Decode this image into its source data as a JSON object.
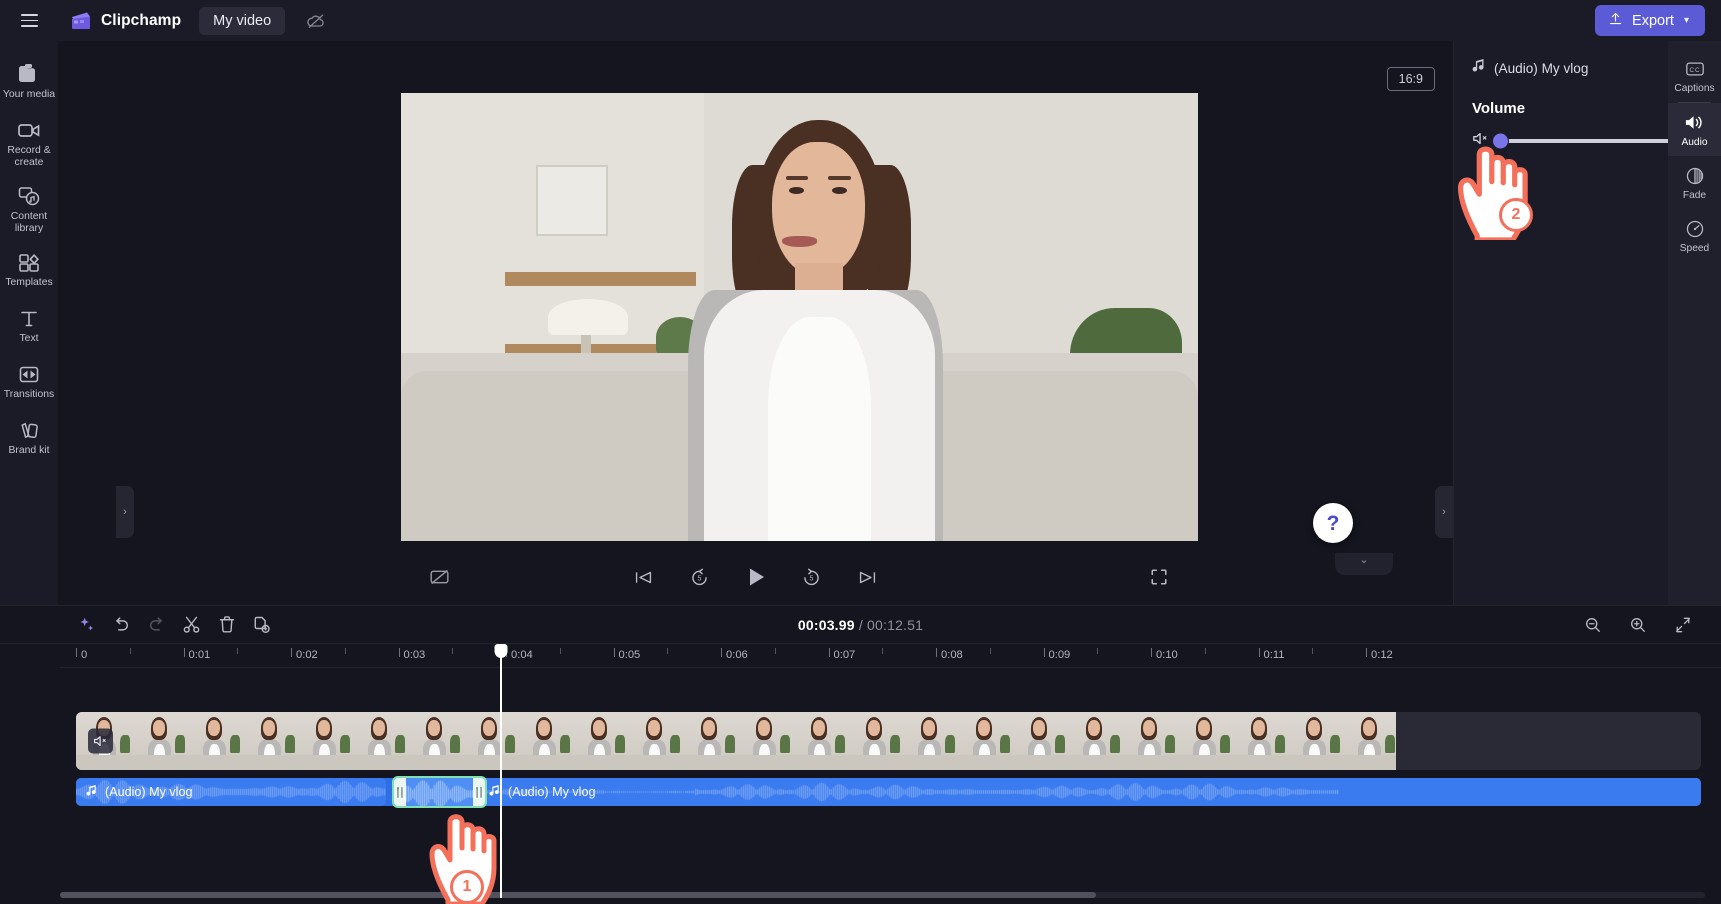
{
  "topbar": {
    "menu_icon": "hamburger-icon",
    "brand": "Clipchamp",
    "project_name": "My video",
    "cloud_icon": "cloud-off-icon",
    "export_label": "Export",
    "export_chevron": "▾",
    "export_color": "#5b5bd6"
  },
  "sidebar": {
    "items": [
      {
        "label": "Your media",
        "icon": "media-folder-icon"
      },
      {
        "label": "Record & create",
        "icon": "video-camera-icon"
      },
      {
        "label": "Content library",
        "icon": "content-library-icon"
      },
      {
        "label": "Templates",
        "icon": "templates-grid-icon"
      },
      {
        "label": "Text",
        "icon": "text-t-icon"
      },
      {
        "label": "Transitions",
        "icon": "transitions-icon"
      },
      {
        "label": "Brand kit",
        "icon": "brand-kit-icon"
      }
    ],
    "collapse_left_icon": "chevron-right-icon",
    "collapse_right_icon": "chevron-right-icon"
  },
  "stage": {
    "aspect_ratio_badge": "16:9",
    "help_icon": "question-mark-icon",
    "panel_collapse_icon": "chevron-down-icon"
  },
  "player": {
    "captions_icon": "captions-off-icon",
    "prev_icon": "skip-previous-icon",
    "back5_icon": "rewind-5-icon",
    "play_icon": "play-icon",
    "fwd5_icon": "forward-5-icon",
    "next_icon": "skip-next-icon",
    "fullscreen_icon": "fullscreen-icon"
  },
  "properties": {
    "clip_title": "(Audio) My vlog",
    "clip_icon": "music-note-icon",
    "section_title": "Volume",
    "volume_value": "0%",
    "volume_percent": 0,
    "mute_icon": "volume-mute-icon",
    "max_icon": "volume-high-icon",
    "slider_thumb_color": "#7b74e8",
    "tabs": [
      {
        "label": "Captions",
        "icon": "closed-caption-icon",
        "active": false
      },
      {
        "label": "Audio",
        "icon": "volume-high-icon",
        "active": true
      },
      {
        "label": "Fade",
        "icon": "fade-circle-icon",
        "active": false
      },
      {
        "label": "Speed",
        "icon": "speedometer-icon",
        "active": false
      }
    ]
  },
  "timeline": {
    "tools": [
      {
        "name": "magic-wand-icon",
        "dim": false
      },
      {
        "name": "undo-icon",
        "dim": false
      },
      {
        "name": "redo-icon",
        "dim": true
      },
      {
        "name": "split-scissors-icon",
        "dim": false
      },
      {
        "name": "delete-trash-icon",
        "dim": false
      },
      {
        "name": "duplicate-icon",
        "dim": false
      }
    ],
    "current_time": "00:03.99",
    "separator": "/",
    "total_time": "00:12.51",
    "zoom_out_icon": "zoom-out-icon",
    "zoom_in_icon": "zoom-in-icon",
    "fit_icon": "fit-to-screen-icon",
    "ruler_labels": [
      "0",
      "0:01",
      "0:02",
      "0:03",
      "0:04",
      "0:05",
      "0:06",
      "0:07",
      "0:08",
      "0:09",
      "0:10",
      "0:11",
      "0:12"
    ],
    "playhead_time": "00:03.99",
    "video_track": {
      "name": "video-clip",
      "muted": true,
      "mute_icon": "volume-mute-icon"
    },
    "audio_clips": [
      {
        "label": "(Audio) My vlog",
        "icon": "music-note-icon",
        "selected": false
      },
      {
        "label": "(Audio) My vlog",
        "icon": "music-note-icon",
        "selected": false
      }
    ],
    "selected_segment": {
      "label": "",
      "selected": true,
      "border_color": "#7fe0b0"
    }
  },
  "callouts": [
    {
      "number": "1",
      "target": "timeline-selected-clip"
    },
    {
      "number": "2",
      "target": "volume-slider-thumb"
    }
  ]
}
